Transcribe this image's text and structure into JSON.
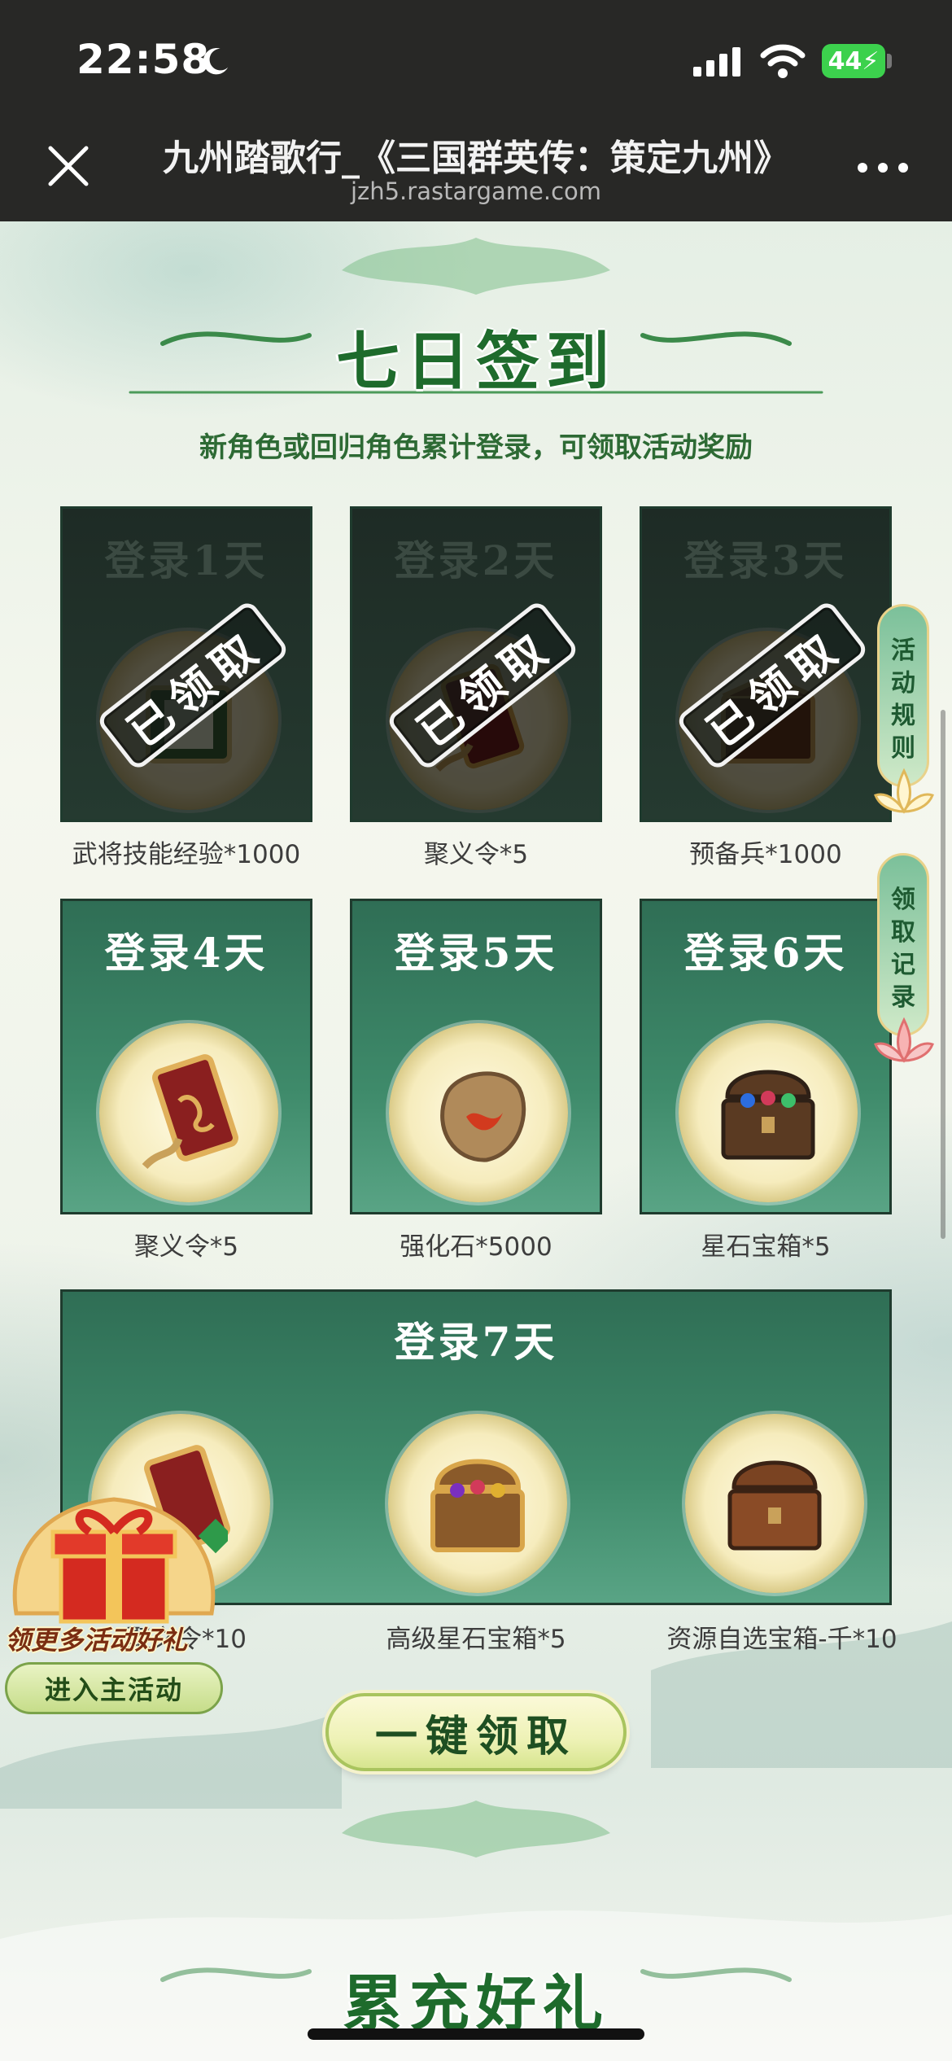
{
  "status_bar": {
    "time": "22:58",
    "battery": "44"
  },
  "browser": {
    "title": "九州踏歌行_《三国群英传：策定九州》",
    "url": "jzh5.rastargame.com"
  },
  "signin": {
    "title": "七日签到",
    "subtitle": "新角色或回归角色累计登录，可领取活动奖励",
    "claimed_stamp": "已领取",
    "days": [
      {
        "day": "登录1天",
        "reward": "武将技能经验*1000",
        "claimed": true,
        "icon": "jade-book-icon"
      },
      {
        "day": "登录2天",
        "reward": "聚义令*5",
        "claimed": true,
        "icon": "dragon-token-icon"
      },
      {
        "day": "登录3天",
        "reward": "预备兵*1000",
        "claimed": true,
        "icon": "supply-crate-icon"
      },
      {
        "day": "登录4天",
        "reward": "聚义令*5",
        "claimed": false,
        "icon": "dragon-token-icon"
      },
      {
        "day": "登录5天",
        "reward": "强化石*5000",
        "claimed": false,
        "icon": "enhance-stone-icon"
      },
      {
        "day": "登录6天",
        "reward": "星石宝箱*5",
        "claimed": false,
        "icon": "gem-chest-icon"
      }
    ],
    "day7": {
      "day": "登录7天",
      "rewards": [
        {
          "reward": "聚义令*10",
          "icon": "dragon-token-icon"
        },
        {
          "reward": "高级星石宝箱*5",
          "icon": "gold-gem-chest-icon"
        },
        {
          "reward": "资源自选宝箱-千*10",
          "icon": "resource-chest-icon"
        }
      ]
    },
    "claim_all": "一键领取"
  },
  "side_tabs": {
    "rules": "活动规则",
    "records": "领取记录"
  },
  "promo": {
    "text": "领更多活动好礼",
    "button": "进入主活动"
  },
  "next_section": {
    "title": "累充好礼"
  },
  "colors": {
    "accent_green": "#1e6b2c",
    "card_green": "#3e8a6a",
    "claimed_dark": "#1e2b25"
  }
}
